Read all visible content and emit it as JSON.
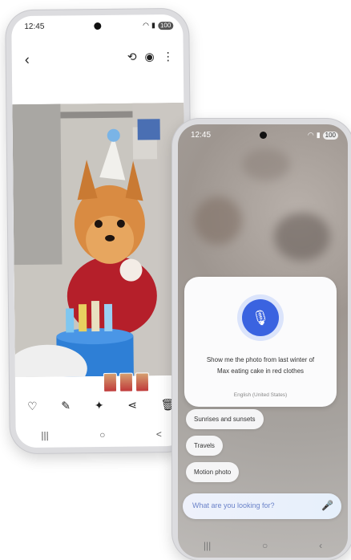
{
  "phone1": {
    "time": "12:45",
    "battery": "100",
    "toolbar": {
      "back_icon": "chevron-left-icon",
      "icons": [
        "remaster-icon",
        "eye-icon",
        "more-vert-icon"
      ]
    },
    "actions": [
      "heart-icon",
      "pencil-icon",
      "sparkle-edit-icon",
      "share-icon",
      "trash-icon"
    ],
    "nav": [
      "|||",
      "○",
      "<"
    ]
  },
  "phone2": {
    "time": "12:45",
    "battery": "100",
    "voice": {
      "query_line1": "Show me the photo from last winter of",
      "query_line2": "Max eating cake in red clothes",
      "language": "English (United States)"
    },
    "chips": [
      "Sunrises and sunsets",
      "Travels",
      "Motion photo"
    ],
    "search_placeholder": "What are you looking for?"
  },
  "colors": {
    "accent": "#3a63e0",
    "mic_ring": "#dbe4fb"
  }
}
